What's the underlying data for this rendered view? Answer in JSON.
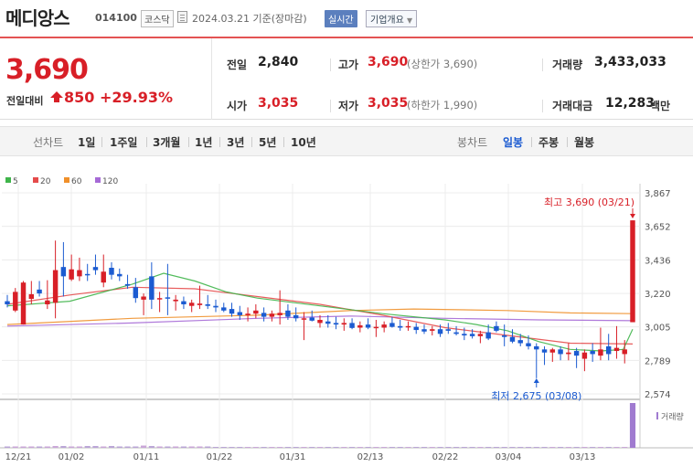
{
  "header": {
    "name": "메디앙스",
    "code": "014100",
    "market": "코스닥",
    "date": "2024.03.21  기준(장마감)",
    "realtime": "실시간",
    "company_info": "기업개요"
  },
  "summary": {
    "price": "3,690",
    "change_label": "전일대비",
    "change": "850",
    "change_rate": "+29.93%",
    "prev_close_label": "전일",
    "prev_close": "2,840",
    "open_label": "시가",
    "open": "3,035",
    "high_label": "고가",
    "high": "3,690",
    "high_limit": "(상한가 3,690)",
    "low_label": "저가",
    "low": "3,035",
    "low_limit": "(하한가 1,990)",
    "volume_label": "거래량",
    "volume": "3,433,033",
    "amount_label": "거래대금",
    "amount": "12,283",
    "amount_unit": "백만"
  },
  "toolbar": {
    "line_chart_label": "선차트",
    "periods": [
      "1일",
      "1주일",
      "3개월",
      "1년",
      "3년",
      "5년",
      "10년"
    ],
    "candle_chart_label": "봉차트",
    "candles": [
      "일봉",
      "주봉",
      "월봉"
    ],
    "selected_candle": "일봉"
  },
  "colors": {
    "up": "#d81f27",
    "down": "#1b5bd1",
    "ma5": "#3fb54a",
    "ma20": "#e54b4b",
    "ma60": "#f0902a",
    "ma120": "#a66ad6"
  },
  "chart_data": {
    "type": "candlestick",
    "legend": [
      "5",
      "20",
      "60",
      "120"
    ],
    "y_ticks": [
      "3,867",
      "3,652",
      "3,436",
      "3,220",
      "3,005",
      "2,789",
      "2,574"
    ],
    "ylim": [
      2574,
      3867
    ],
    "x_ticks": [
      "12/21",
      "01/02",
      "01/11",
      "01/22",
      "01/31",
      "02/13",
      "02/22",
      "03/04",
      "03/13"
    ],
    "high_annotation": "최고 3,690 (03/21)",
    "low_annotation": "최저 2,675 (03/08)",
    "volume_label": "거래량",
    "candles": [
      {
        "o": 3170,
        "h": 3210,
        "l": 3130,
        "c": 3150
      },
      {
        "o": 3110,
        "h": 3255,
        "l": 3100,
        "c": 3230
      },
      {
        "o": 3020,
        "h": 3300,
        "l": 3020,
        "c": 3290
      },
      {
        "o": 3185,
        "h": 3300,
        "l": 3150,
        "c": 3215
      },
      {
        "o": 3245,
        "h": 3300,
        "l": 3200,
        "c": 3220
      },
      {
        "o": 3150,
        "h": 3305,
        "l": 3120,
        "c": 3175
      },
      {
        "o": 3160,
        "h": 3560,
        "l": 3060,
        "c": 3370
      },
      {
        "o": 3390,
        "h": 3550,
        "l": 3200,
        "c": 3330
      },
      {
        "o": 3310,
        "h": 3470,
        "l": 3300,
        "c": 3375
      },
      {
        "o": 3330,
        "h": 3450,
        "l": 3300,
        "c": 3370
      },
      {
        "o": 3345,
        "h": 3410,
        "l": 3300,
        "c": 3340
      },
      {
        "o": 3390,
        "h": 3470,
        "l": 3340,
        "c": 3370
      },
      {
        "o": 3290,
        "h": 3470,
        "l": 3260,
        "c": 3360
      },
      {
        "o": 3385,
        "h": 3420,
        "l": 3310,
        "c": 3340
      },
      {
        "o": 3345,
        "h": 3380,
        "l": 3300,
        "c": 3330
      },
      {
        "o": 3280,
        "h": 3340,
        "l": 3250,
        "c": 3270
      },
      {
        "o": 3260,
        "h": 3320,
        "l": 3160,
        "c": 3190
      },
      {
        "o": 3180,
        "h": 3220,
        "l": 3080,
        "c": 3200
      },
      {
        "o": 3330,
        "h": 3420,
        "l": 3120,
        "c": 3180
      },
      {
        "o": 3190,
        "h": 3230,
        "l": 3100,
        "c": 3190
      },
      {
        "o": 3195,
        "h": 3410,
        "l": 3080,
        "c": 3190
      },
      {
        "o": 3170,
        "h": 3210,
        "l": 3110,
        "c": 3180
      },
      {
        "o": 3170,
        "h": 3200,
        "l": 3120,
        "c": 3150
      },
      {
        "o": 3140,
        "h": 3180,
        "l": 3100,
        "c": 3160
      },
      {
        "o": 3145,
        "h": 3270,
        "l": 3120,
        "c": 3155
      },
      {
        "o": 3150,
        "h": 3210,
        "l": 3120,
        "c": 3140
      },
      {
        "o": 3140,
        "h": 3180,
        "l": 3100,
        "c": 3130
      },
      {
        "o": 3130,
        "h": 3160,
        "l": 3100,
        "c": 3110
      },
      {
        "o": 3120,
        "h": 3160,
        "l": 3070,
        "c": 3090
      },
      {
        "o": 3100,
        "h": 3140,
        "l": 3050,
        "c": 3080
      },
      {
        "o": 3080,
        "h": 3130,
        "l": 3040,
        "c": 3090
      },
      {
        "o": 3090,
        "h": 3150,
        "l": 3060,
        "c": 3110
      },
      {
        "o": 3095,
        "h": 3130,
        "l": 3040,
        "c": 3070
      },
      {
        "o": 3070,
        "h": 3110,
        "l": 3040,
        "c": 3090
      },
      {
        "o": 3080,
        "h": 3240,
        "l": 3020,
        "c": 3095
      },
      {
        "o": 3110,
        "h": 3150,
        "l": 3050,
        "c": 3070
      },
      {
        "o": 3080,
        "h": 3130,
        "l": 3040,
        "c": 3060
      },
      {
        "o": 3060,
        "h": 3100,
        "l": 2920,
        "c": 3060
      },
      {
        "o": 3065,
        "h": 3110,
        "l": 3040,
        "c": 3045
      },
      {
        "o": 3030,
        "h": 3080,
        "l": 3000,
        "c": 3050
      },
      {
        "o": 3040,
        "h": 3080,
        "l": 3000,
        "c": 3025
      },
      {
        "o": 3030,
        "h": 3070,
        "l": 2990,
        "c": 3020
      },
      {
        "o": 3020,
        "h": 3060,
        "l": 2980,
        "c": 3030
      },
      {
        "o": 3030,
        "h": 3060,
        "l": 2990,
        "c": 2998
      },
      {
        "o": 3000,
        "h": 3040,
        "l": 2970,
        "c": 3015
      },
      {
        "o": 3020,
        "h": 3060,
        "l": 2990,
        "c": 3000
      },
      {
        "o": 3005,
        "h": 3050,
        "l": 2940,
        "c": 3005
      },
      {
        "o": 3000,
        "h": 3040,
        "l": 2970,
        "c": 3020
      },
      {
        "o": 3030,
        "h": 3070,
        "l": 3000,
        "c": 3005
      },
      {
        "o": 3010,
        "h": 3050,
        "l": 2980,
        "c": 3000
      },
      {
        "o": 3010,
        "h": 3040,
        "l": 2980,
        "c": 3010
      },
      {
        "o": 3005,
        "h": 3030,
        "l": 2960,
        "c": 2985
      },
      {
        "o": 2990,
        "h": 3020,
        "l": 2960,
        "c": 2975
      },
      {
        "o": 2980,
        "h": 3010,
        "l": 2950,
        "c": 2990
      },
      {
        "o": 2990,
        "h": 3020,
        "l": 2940,
        "c": 2960
      },
      {
        "o": 2990,
        "h": 3030,
        "l": 2960,
        "c": 2980
      },
      {
        "o": 2970,
        "h": 3010,
        "l": 2950,
        "c": 2960
      },
      {
        "o": 2960,
        "h": 3000,
        "l": 2920,
        "c": 2950
      },
      {
        "o": 2960,
        "h": 2990,
        "l": 2930,
        "c": 2945
      },
      {
        "o": 2945,
        "h": 2980,
        "l": 2900,
        "c": 2960
      },
      {
        "o": 2970,
        "h": 3020,
        "l": 2920,
        "c": 2930
      },
      {
        "o": 3010,
        "h": 3040,
        "l": 2970,
        "c": 2980
      },
      {
        "o": 2950,
        "h": 3020,
        "l": 2880,
        "c": 2940
      },
      {
        "o": 2940,
        "h": 2990,
        "l": 2900,
        "c": 2910
      },
      {
        "o": 2920,
        "h": 2960,
        "l": 2880,
        "c": 2900
      },
      {
        "o": 2900,
        "h": 2950,
        "l": 2860,
        "c": 2880
      },
      {
        "o": 2880,
        "h": 2900,
        "l": 2675,
        "c": 2860
      },
      {
        "o": 2860,
        "h": 2880,
        "l": 2760,
        "c": 2840
      },
      {
        "o": 2840,
        "h": 2870,
        "l": 2780,
        "c": 2860
      },
      {
        "o": 2860,
        "h": 2880,
        "l": 2790,
        "c": 2830
      },
      {
        "o": 2830,
        "h": 2900,
        "l": 2790,
        "c": 2840
      },
      {
        "o": 2850,
        "h": 2870,
        "l": 2740,
        "c": 2820
      },
      {
        "o": 2800,
        "h": 2860,
        "l": 2720,
        "c": 2840
      },
      {
        "o": 2850,
        "h": 2900,
        "l": 2780,
        "c": 2830
      },
      {
        "o": 2820,
        "h": 3000,
        "l": 2790,
        "c": 2860
      },
      {
        "o": 2880,
        "h": 2960,
        "l": 2790,
        "c": 2830
      },
      {
        "o": 2850,
        "h": 3010,
        "l": 2800,
        "c": 2870
      },
      {
        "o": 2830,
        "h": 2920,
        "l": 2770,
        "c": 2860
      },
      {
        "o": 3035,
        "h": 3690,
        "l": 3035,
        "c": 3690
      }
    ],
    "ma5": [
      [
        0,
        3140
      ],
      [
        0.1,
        3170
      ],
      [
        0.2,
        3280
      ],
      [
        0.25,
        3350
      ],
      [
        0.3,
        3300
      ],
      [
        0.35,
        3230
      ],
      [
        0.4,
        3190
      ],
      [
        0.5,
        3140
      ],
      [
        0.6,
        3090
      ],
      [
        0.7,
        3050
      ],
      [
        0.75,
        3020
      ],
      [
        0.8,
        2980
      ],
      [
        0.85,
        2910
      ],
      [
        0.9,
        2860
      ],
      [
        0.95,
        2850
      ],
      [
        0.985,
        2860
      ],
      [
        1.0,
        2990
      ]
    ],
    "ma20": [
      [
        0,
        3150
      ],
      [
        0.1,
        3210
      ],
      [
        0.2,
        3260
      ],
      [
        0.3,
        3250
      ],
      [
        0.4,
        3200
      ],
      [
        0.5,
        3150
      ],
      [
        0.6,
        3080
      ],
      [
        0.7,
        3000
      ],
      [
        0.8,
        2950
      ],
      [
        0.9,
        2900
      ],
      [
        1.0,
        2895
      ]
    ],
    "ma60": [
      [
        0,
        3020
      ],
      [
        0.2,
        3060
      ],
      [
        0.4,
        3080
      ],
      [
        0.55,
        3110
      ],
      [
        0.65,
        3120
      ],
      [
        0.8,
        3110
      ],
      [
        0.9,
        3095
      ],
      [
        1.0,
        3090
      ]
    ],
    "ma120": [
      [
        0,
        3010
      ],
      [
        0.2,
        3030
      ],
      [
        0.4,
        3060
      ],
      [
        0.55,
        3075
      ],
      [
        0.7,
        3060
      ],
      [
        0.85,
        3050
      ],
      [
        1.0,
        3045
      ]
    ],
    "volumes": [
      0.03,
      0.03,
      0.03,
      0.03,
      0.03,
      0.03,
      0.04,
      0.04,
      0.03,
      0.03,
      0.04,
      0.04,
      0.03,
      0.04,
      0.03,
      0.03,
      0.03,
      0.05,
      0.04,
      0.03,
      0.03,
      0.03,
      0.03,
      0.03,
      0.03,
      0.03,
      0.02,
      0.02,
      0.02,
      0.02,
      0.02,
      0.02,
      0.02,
      0.02,
      0.02,
      0.02,
      0.02,
      0.02,
      0.02,
      0.02,
      0.02,
      0.02,
      0.02,
      0.02,
      0.02,
      0.02,
      0.02,
      0.02,
      0.02,
      0.02,
      0.02,
      0.02,
      0.02,
      0.02,
      0.02,
      0.02,
      0.02,
      0.02,
      0.02,
      0.02,
      0.02,
      0.02,
      0.02,
      0.02,
      0.02,
      0.02,
      0.02,
      0.02,
      0.02,
      0.02,
      0.02,
      0.02,
      0.02,
      0.02,
      0.02,
      0.02,
      0.02,
      0.02,
      1.0
    ]
  }
}
